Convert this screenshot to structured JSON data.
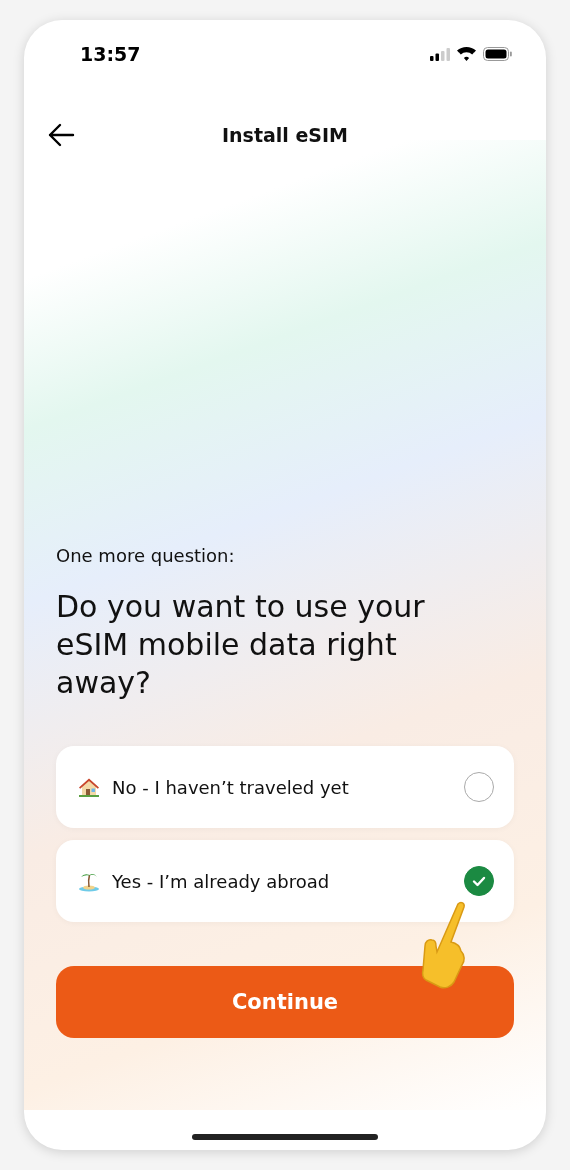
{
  "status_bar": {
    "time": "13:57"
  },
  "header": {
    "title": "Install eSIM"
  },
  "question": {
    "eyebrow": "One more question:",
    "title": "Do you want to use your eSIM mobile data right away?"
  },
  "options": [
    {
      "kind": "house",
      "label": "No - I haven’t traveled yet",
      "selected": false
    },
    {
      "kind": "island",
      "label": "Yes - I’m already abroad",
      "selected": true
    }
  ],
  "primary_button": {
    "label": "Continue"
  }
}
